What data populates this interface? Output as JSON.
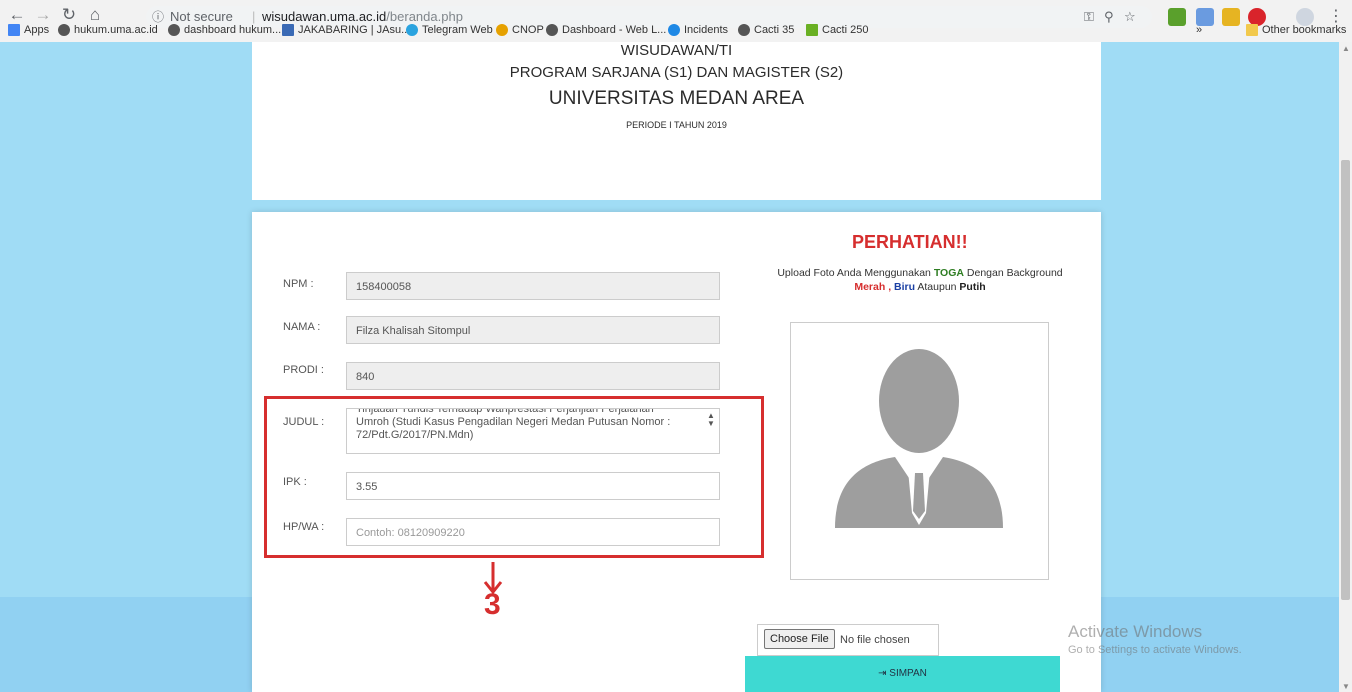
{
  "browser": {
    "secure_label": "Not secure",
    "separator": "|",
    "url_host": "wisudawan.uma.ac.id",
    "url_path": "/beranda.php",
    "bookmarks": [
      {
        "label": "Apps",
        "color": "#4285f4"
      },
      {
        "label": "hukum.uma.ac.id",
        "color": "#555555"
      },
      {
        "label": "dashboard hukum...",
        "color": "#555555"
      },
      {
        "label": "JAKABARING | JAsu...",
        "color": "#3a6ab5"
      },
      {
        "label": "Telegram Web",
        "color": "#2aa3df"
      },
      {
        "label": "CNOP",
        "color": "#e6a100"
      },
      {
        "label": "Dashboard - Web L...",
        "color": "#555555"
      },
      {
        "label": "Incidents",
        "color": "#1e88e5"
      },
      {
        "label": "Cacti 35",
        "color": "#555555"
      },
      {
        "label": "Cacti 250",
        "color": "#6ab023"
      }
    ],
    "overflow_label": "»",
    "other_bookmarks": "Other bookmarks"
  },
  "header": {
    "line1": "WISUDAWAN/TI",
    "line2": "PROGRAM SARJANA (S1) DAN MAGISTER (S2)",
    "line3": "UNIVERSITAS MEDAN AREA",
    "period": "PERIODE I TAHUN 2019"
  },
  "form": {
    "npm_label": "NPM :",
    "npm_value": "158400058",
    "nama_label": "NAMA :",
    "nama_value": "Filza Khalisah Sitompul",
    "prodi_label": "PRODI :",
    "prodi_value": "840",
    "judul_label": "JUDUL :",
    "judul_line1": "Tinjauan Yuridis Terhadap Wanprestasi Perjanjian Perjalanan",
    "judul_line2": "Umroh (Studi Kasus Pengadilan Negeri Medan Putusan Nomor :",
    "judul_line3": "72/Pdt.G/2017/PN.Mdn)",
    "ipk_label": "IPK :",
    "ipk_value": "3.55",
    "hp_label": "HP/WA :",
    "hp_placeholder": "Contoh: 08120909220"
  },
  "annotation": {
    "step_number": "3",
    "color": "#d62e2e"
  },
  "notice": {
    "title": "PERHATIAN!!",
    "text_pre": "Upload Foto Anda Menggunakan",
    "toga": "TOGA",
    "text_mid": "Dengan Background",
    "merah": "Merah",
    "comma": ",",
    "biru": "Biru",
    "ataupun": "Ataupun",
    "putih": "Putih"
  },
  "upload": {
    "choose_label": "Choose File",
    "no_file": "No file chosen"
  },
  "submit": {
    "label": "SIMPAN",
    "color": "#3ed9d2"
  },
  "watermark": {
    "line1": "Activate Windows",
    "line2": "Go to Settings to activate Windows."
  }
}
